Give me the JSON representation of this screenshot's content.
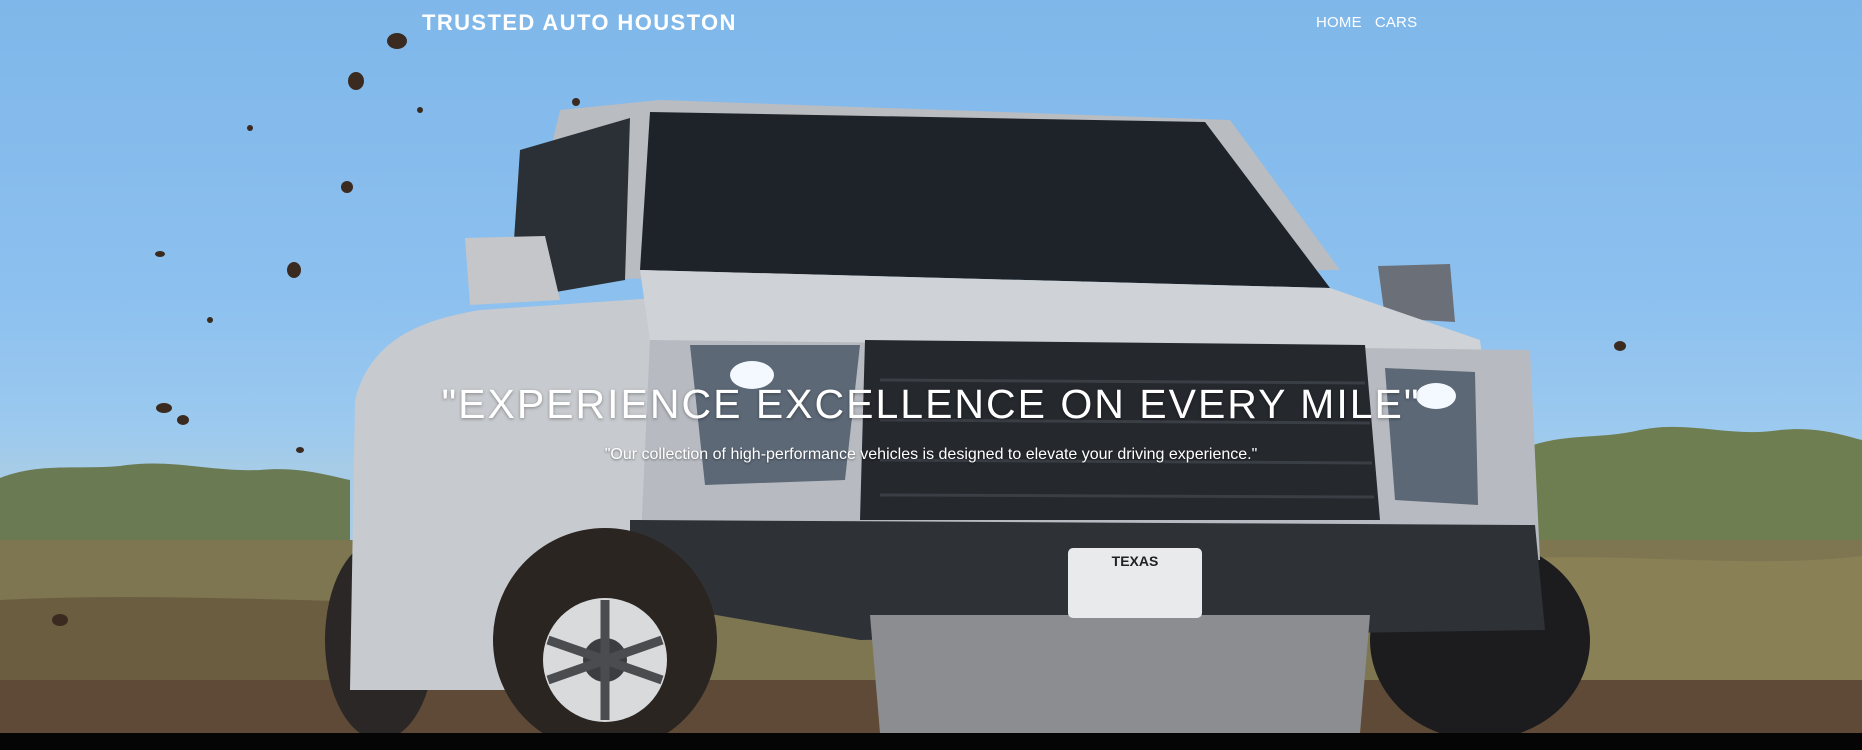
{
  "header": {
    "brand": "TRUSTED AUTO HOUSTON",
    "nav": [
      {
        "label": "HOME"
      },
      {
        "label": "CARS"
      }
    ]
  },
  "hero": {
    "headline": "\"EXPERIENCE EXCELLENCE ON EVERY MILE\"",
    "subheadline": "\"Our collection of high-performance vehicles is designed to elevate your driving experience.\"",
    "image": "pickup-truck-offroad-mud",
    "plate_text": "TEXAS"
  },
  "colors": {
    "sky": "#8cc0ef",
    "truck_body": "#c9ccd1",
    "text": "#ffffff",
    "footer_bar": "#050505"
  }
}
